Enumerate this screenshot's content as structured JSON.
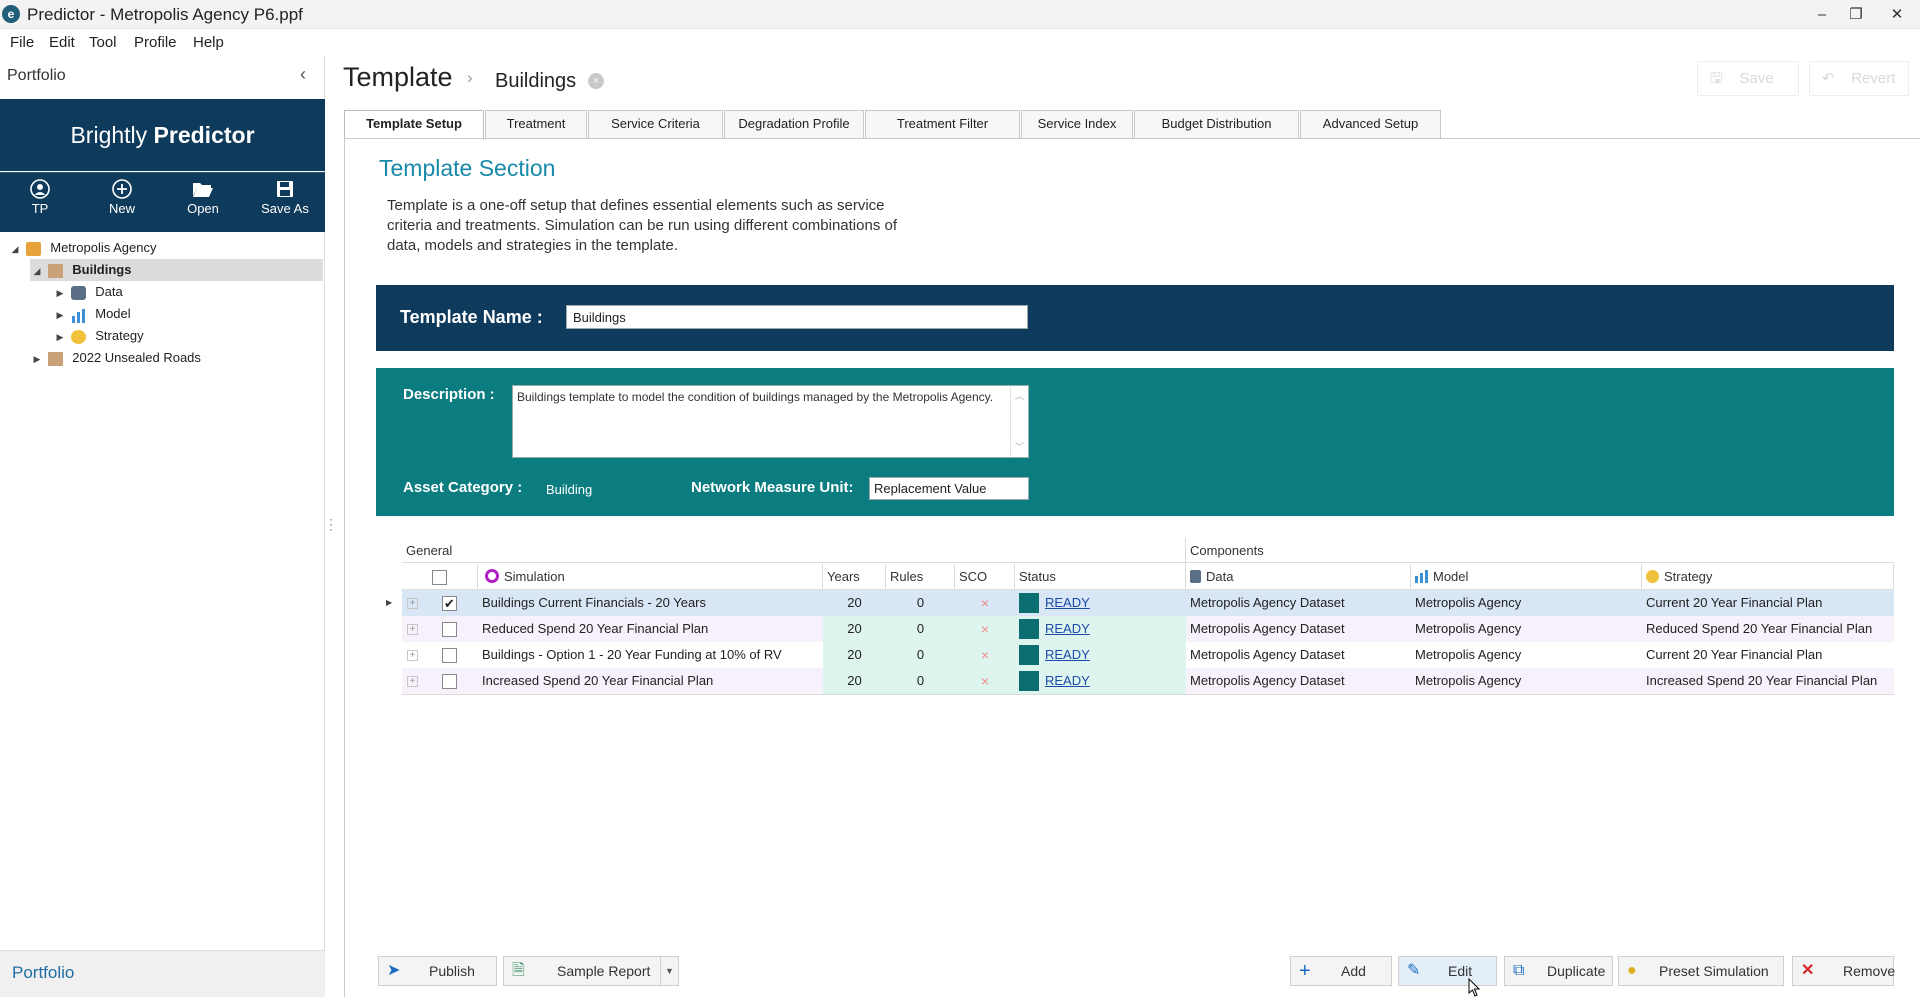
{
  "window": {
    "title": "Predictor - Metropolis Agency P6.ppf",
    "minimize": "–",
    "restore": "❐",
    "close": "✕"
  },
  "menu": [
    "File",
    "Edit",
    "Tool",
    "Profile",
    "Help"
  ],
  "left": {
    "header": "Portfolio",
    "collapse": "‹",
    "brand_light": "Brightly ",
    "brand_bold": "Predictor",
    "tools": [
      {
        "label": "TP",
        "icon": "user-icon",
        "glyph": "●"
      },
      {
        "label": "New",
        "icon": "plus-circle-icon",
        "glyph": "⊕"
      },
      {
        "label": "Open",
        "icon": "folder-open-icon",
        "glyph": "🗁"
      },
      {
        "label": "Save As",
        "icon": "save-icon",
        "glyph": "🖫"
      }
    ],
    "tree": [
      {
        "label": "Metropolis Agency",
        "icon": "agency-icon",
        "expanded": true
      },
      {
        "label": "Buildings",
        "icon": "template-icon",
        "expanded": true,
        "selected": true
      },
      {
        "label": "Data",
        "icon": "database-icon"
      },
      {
        "label": "Model",
        "icon": "chart-icon"
      },
      {
        "label": "Strategy",
        "icon": "strategy-icon"
      },
      {
        "label": "2022 Unsealed Roads",
        "icon": "template-icon"
      }
    ],
    "footer": "Portfolio"
  },
  "breadcrumb": {
    "root": "Template",
    "separator": "›",
    "current": "Buildings",
    "close": "×"
  },
  "top_actions": {
    "save": "Save",
    "revert": "Revert"
  },
  "tabs": [
    "Template Setup",
    "Treatment",
    "Service Criteria",
    "Degradation Profile",
    "Treatment Filter",
    "Service Index",
    "Budget Distribution",
    "Advanced Setup"
  ],
  "section": {
    "title": "Template Section",
    "description": "Template is a one-off setup that defines essential elements such as service criteria and treatments. Simulation can be run using different combinations of data, models and strategies in the template."
  },
  "form": {
    "name_label": "Template Name :",
    "name_value": "Buildings",
    "description_label": "Description :",
    "description_value": "Buildings template to model the condition of buildings managed by the Metropolis Agency.",
    "asset_category_label": "Asset Category :",
    "asset_category_value": "Building",
    "unit_label": "Network Measure Unit:",
    "unit_value": "Replacement Value"
  },
  "grid": {
    "band_general": "General",
    "band_components": "Components",
    "headers": {
      "simulation": "Simulation",
      "years": "Years",
      "rules": "Rules",
      "sco": "SCO",
      "status": "Status",
      "data": "Data",
      "model": "Model",
      "strategy": "Strategy"
    },
    "rows": [
      {
        "checked": "✔",
        "name": "Buildings Current Financials - 20 Years",
        "years": "20",
        "rules": "0",
        "sco": "×",
        "status": "READY",
        "data": "Metropolis Agency Dataset",
        "model": "Metropolis Agency",
        "strategy": "Current 20 Year Financial Plan"
      },
      {
        "checked": "",
        "name": "Reduced Spend 20 Year Financial Plan",
        "years": "20",
        "rules": "0",
        "sco": "×",
        "status": "READY",
        "data": "Metropolis Agency Dataset",
        "model": "Metropolis Agency",
        "strategy": "Reduced Spend 20 Year Financial Plan"
      },
      {
        "checked": "",
        "name": "Buildings - Option 1 - 20 Year Funding at 10% of RV",
        "years": "20",
        "rules": "0",
        "sco": "×",
        "status": "READY",
        "data": "Metropolis Agency Dataset",
        "model": "Metropolis Agency",
        "strategy": "Current 20 Year Financial Plan"
      },
      {
        "checked": "",
        "name": "Increased Spend 20 Year Financial Plan",
        "years": "20",
        "rules": "0",
        "sco": "×",
        "status": "READY",
        "data": "Metropolis Agency Dataset",
        "model": "Metropolis Agency",
        "strategy": "Increased Spend 20 Year Financial Plan"
      }
    ]
  },
  "bottom_buttons": {
    "publish": "Publish",
    "sample_report": "Sample Report",
    "add": "Add",
    "edit": "Edit",
    "duplicate": "Duplicate",
    "preset_simulation": "Preset Simulation",
    "remove": "Remove"
  },
  "colors": {
    "navy": "#0e3a5c",
    "teal": "#0b7c80",
    "accent_title": "#1889a8",
    "link": "#1b4aa8"
  }
}
